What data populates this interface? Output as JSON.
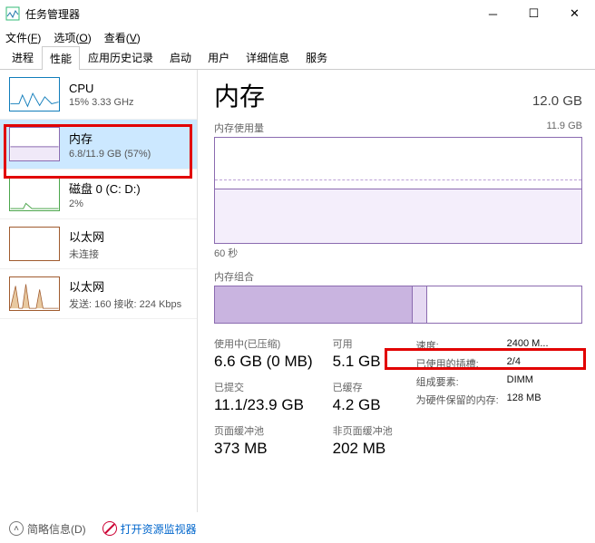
{
  "window": {
    "title": "任务管理器"
  },
  "menu": {
    "file": "文件(",
    "file_u": "F",
    "file_end": ")",
    "options": "选项(",
    "options_u": "O",
    "options_end": ")",
    "view": "查看(",
    "view_u": "V",
    "view_end": ")"
  },
  "tabs": [
    "进程",
    "性能",
    "应用历史记录",
    "启动",
    "用户",
    "详细信息",
    "服务"
  ],
  "sidebar": [
    {
      "name": "CPU",
      "sub": "15% 3.33 GHz",
      "type": "cpu"
    },
    {
      "name": "内存",
      "sub": "6.8/11.9 GB (57%)",
      "type": "mem",
      "selected": true
    },
    {
      "name": "磁盘 0 (C: D:)",
      "sub": "2%",
      "type": "disk"
    },
    {
      "name": "以太网",
      "sub": "未连接",
      "type": "net"
    },
    {
      "name": "以太网",
      "sub": "发送: 160 接收: 224 Kbps",
      "type": "net2"
    }
  ],
  "header": {
    "title": "内存",
    "capacity": "12.0 GB"
  },
  "graph1": {
    "label": "内存使用量",
    "max": "11.9 GB",
    "footer": "60 秒"
  },
  "graph2": {
    "label": "内存组合"
  },
  "stats": {
    "in_use": {
      "label": "使用中(已压缩)",
      "value": "6.6 GB (0 MB)"
    },
    "avail": {
      "label": "可用",
      "value": "5.1 GB"
    },
    "commit": {
      "label": "已提交",
      "value": "11.1/23.9 GB"
    },
    "cached": {
      "label": "已缓存",
      "value": "4.2 GB"
    },
    "paged": {
      "label": "页面缓冲池",
      "value": "373 MB"
    },
    "nonpaged": {
      "label": "非页面缓冲池",
      "value": "202 MB"
    }
  },
  "specs": [
    {
      "k": "速度:",
      "v": "2400 M..."
    },
    {
      "k": "已使用的插槽:",
      "v": "2/4"
    },
    {
      "k": "组成要素:",
      "v": "DIMM"
    },
    {
      "k": "为硬件保留的内存:",
      "v": "128 MB"
    }
  ],
  "bottom": {
    "fewer": "简略信息(",
    "fewer_u": "D",
    "fewer_end": ")",
    "resmon": "打开资源监视器"
  }
}
